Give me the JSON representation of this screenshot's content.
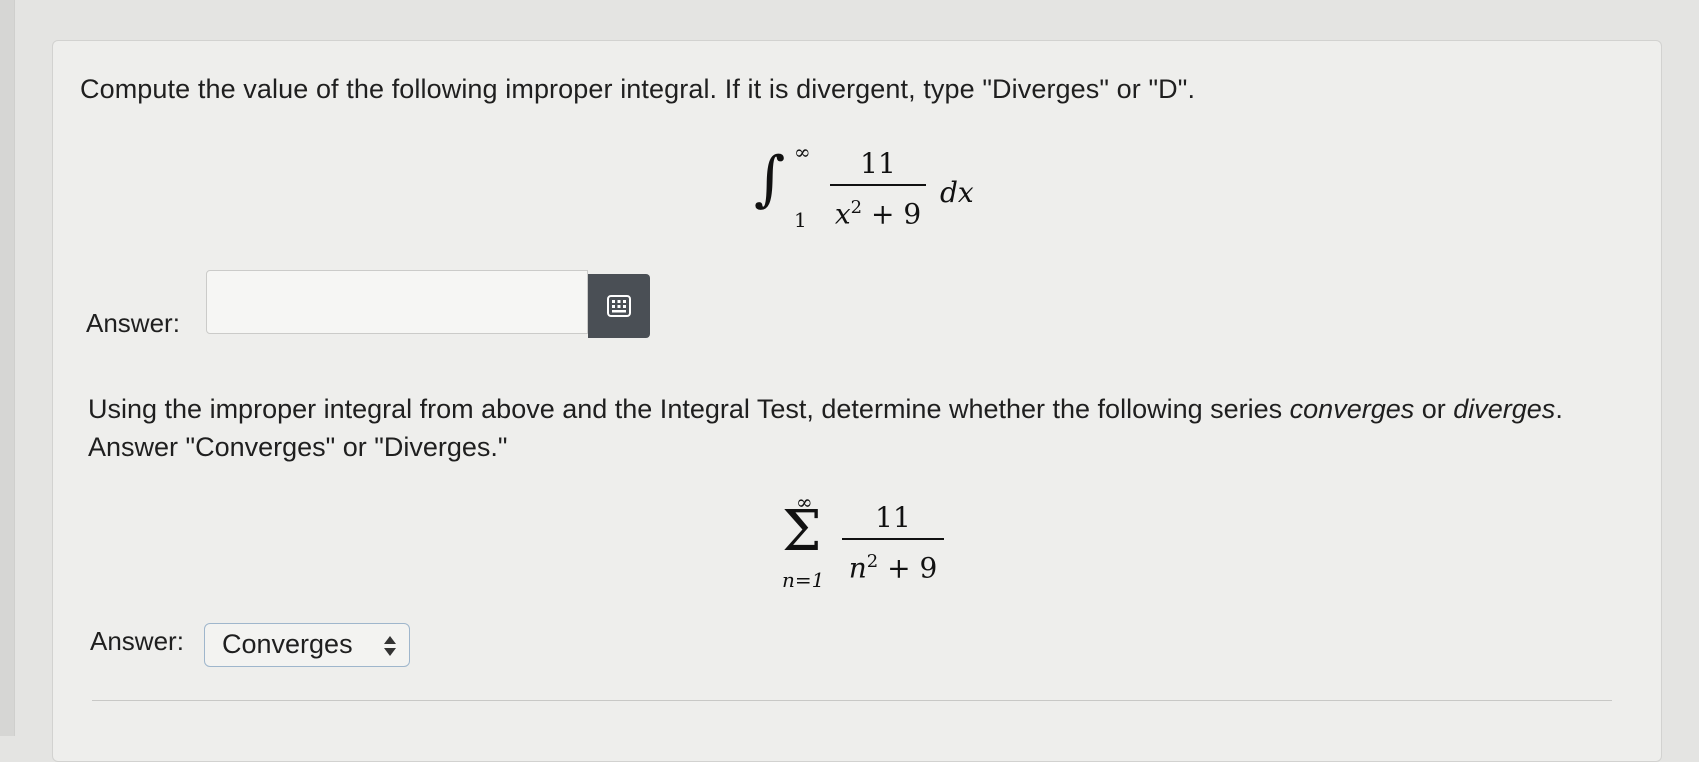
{
  "question1": {
    "prompt": "Compute the value of the following improper integral. If it is divergent, type \"Diverges\" or \"D\".",
    "integral": {
      "upper_limit": "∞",
      "lower_limit": "1",
      "numerator": "11",
      "denominator_var": "x",
      "denominator_exp": "2",
      "denominator_rest": " + 9",
      "differential": "dx"
    },
    "answer_label": "Answer:",
    "answer_value": ""
  },
  "question2": {
    "prompt_part1": "Using the improper integral from above and the Integral Test, determine whether the following series ",
    "prompt_converges": "converges",
    "prompt_part2": " or ",
    "prompt_diverges": "diverges",
    "prompt_part3": ". Answer \"Converges\" or \"Diverges.\"",
    "series": {
      "upper_limit": "∞",
      "sigma": "Σ",
      "lower_limit": "n=1",
      "numerator": "11",
      "denominator_var": "n",
      "denominator_exp": "2",
      "denominator_rest": " + 9"
    },
    "answer_label": "Answer:",
    "selected_option": "Converges"
  },
  "icons": {
    "keyboard_button": "keypad-icon",
    "select_arrows": "sort-arrows-icon"
  },
  "colors": {
    "keypad_button_bg": "#4a4f55",
    "select_border": "#9fb6cc"
  }
}
